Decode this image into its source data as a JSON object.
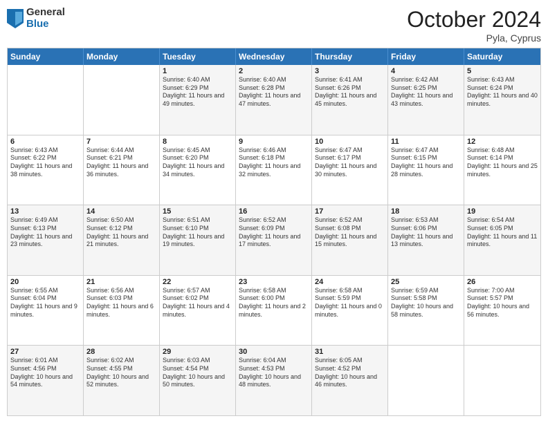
{
  "header": {
    "logo": {
      "general": "General",
      "blue": "Blue"
    },
    "title": "October 2024",
    "location": "Pyla, Cyprus"
  },
  "days_of_week": [
    "Sunday",
    "Monday",
    "Tuesday",
    "Wednesday",
    "Thursday",
    "Friday",
    "Saturday"
  ],
  "rows": [
    [
      {
        "day": "",
        "text": "",
        "empty": true
      },
      {
        "day": "",
        "text": "",
        "empty": true
      },
      {
        "day": "1",
        "text": "Sunrise: 6:40 AM\nSunset: 6:29 PM\nDaylight: 11 hours and 49 minutes."
      },
      {
        "day": "2",
        "text": "Sunrise: 6:40 AM\nSunset: 6:28 PM\nDaylight: 11 hours and 47 minutes."
      },
      {
        "day": "3",
        "text": "Sunrise: 6:41 AM\nSunset: 6:26 PM\nDaylight: 11 hours and 45 minutes."
      },
      {
        "day": "4",
        "text": "Sunrise: 6:42 AM\nSunset: 6:25 PM\nDaylight: 11 hours and 43 minutes."
      },
      {
        "day": "5",
        "text": "Sunrise: 6:43 AM\nSunset: 6:24 PM\nDaylight: 11 hours and 40 minutes."
      }
    ],
    [
      {
        "day": "6",
        "text": "Sunrise: 6:43 AM\nSunset: 6:22 PM\nDaylight: 11 hours and 38 minutes."
      },
      {
        "day": "7",
        "text": "Sunrise: 6:44 AM\nSunset: 6:21 PM\nDaylight: 11 hours and 36 minutes."
      },
      {
        "day": "8",
        "text": "Sunrise: 6:45 AM\nSunset: 6:20 PM\nDaylight: 11 hours and 34 minutes."
      },
      {
        "day": "9",
        "text": "Sunrise: 6:46 AM\nSunset: 6:18 PM\nDaylight: 11 hours and 32 minutes."
      },
      {
        "day": "10",
        "text": "Sunrise: 6:47 AM\nSunset: 6:17 PM\nDaylight: 11 hours and 30 minutes."
      },
      {
        "day": "11",
        "text": "Sunrise: 6:47 AM\nSunset: 6:15 PM\nDaylight: 11 hours and 28 minutes."
      },
      {
        "day": "12",
        "text": "Sunrise: 6:48 AM\nSunset: 6:14 PM\nDaylight: 11 hours and 25 minutes."
      }
    ],
    [
      {
        "day": "13",
        "text": "Sunrise: 6:49 AM\nSunset: 6:13 PM\nDaylight: 11 hours and 23 minutes."
      },
      {
        "day": "14",
        "text": "Sunrise: 6:50 AM\nSunset: 6:12 PM\nDaylight: 11 hours and 21 minutes."
      },
      {
        "day": "15",
        "text": "Sunrise: 6:51 AM\nSunset: 6:10 PM\nDaylight: 11 hours and 19 minutes."
      },
      {
        "day": "16",
        "text": "Sunrise: 6:52 AM\nSunset: 6:09 PM\nDaylight: 11 hours and 17 minutes."
      },
      {
        "day": "17",
        "text": "Sunrise: 6:52 AM\nSunset: 6:08 PM\nDaylight: 11 hours and 15 minutes."
      },
      {
        "day": "18",
        "text": "Sunrise: 6:53 AM\nSunset: 6:06 PM\nDaylight: 11 hours and 13 minutes."
      },
      {
        "day": "19",
        "text": "Sunrise: 6:54 AM\nSunset: 6:05 PM\nDaylight: 11 hours and 11 minutes."
      }
    ],
    [
      {
        "day": "20",
        "text": "Sunrise: 6:55 AM\nSunset: 6:04 PM\nDaylight: 11 hours and 9 minutes."
      },
      {
        "day": "21",
        "text": "Sunrise: 6:56 AM\nSunset: 6:03 PM\nDaylight: 11 hours and 6 minutes."
      },
      {
        "day": "22",
        "text": "Sunrise: 6:57 AM\nSunset: 6:02 PM\nDaylight: 11 hours and 4 minutes."
      },
      {
        "day": "23",
        "text": "Sunrise: 6:58 AM\nSunset: 6:00 PM\nDaylight: 11 hours and 2 minutes."
      },
      {
        "day": "24",
        "text": "Sunrise: 6:58 AM\nSunset: 5:59 PM\nDaylight: 11 hours and 0 minutes."
      },
      {
        "day": "25",
        "text": "Sunrise: 6:59 AM\nSunset: 5:58 PM\nDaylight: 10 hours and 58 minutes."
      },
      {
        "day": "26",
        "text": "Sunrise: 7:00 AM\nSunset: 5:57 PM\nDaylight: 10 hours and 56 minutes."
      }
    ],
    [
      {
        "day": "27",
        "text": "Sunrise: 6:01 AM\nSunset: 4:56 PM\nDaylight: 10 hours and 54 minutes."
      },
      {
        "day": "28",
        "text": "Sunrise: 6:02 AM\nSunset: 4:55 PM\nDaylight: 10 hours and 52 minutes."
      },
      {
        "day": "29",
        "text": "Sunrise: 6:03 AM\nSunset: 4:54 PM\nDaylight: 10 hours and 50 minutes."
      },
      {
        "day": "30",
        "text": "Sunrise: 6:04 AM\nSunset: 4:53 PM\nDaylight: 10 hours and 48 minutes."
      },
      {
        "day": "31",
        "text": "Sunrise: 6:05 AM\nSunset: 4:52 PM\nDaylight: 10 hours and 46 minutes."
      },
      {
        "day": "",
        "text": "",
        "empty": true
      },
      {
        "day": "",
        "text": "",
        "empty": true
      }
    ]
  ]
}
